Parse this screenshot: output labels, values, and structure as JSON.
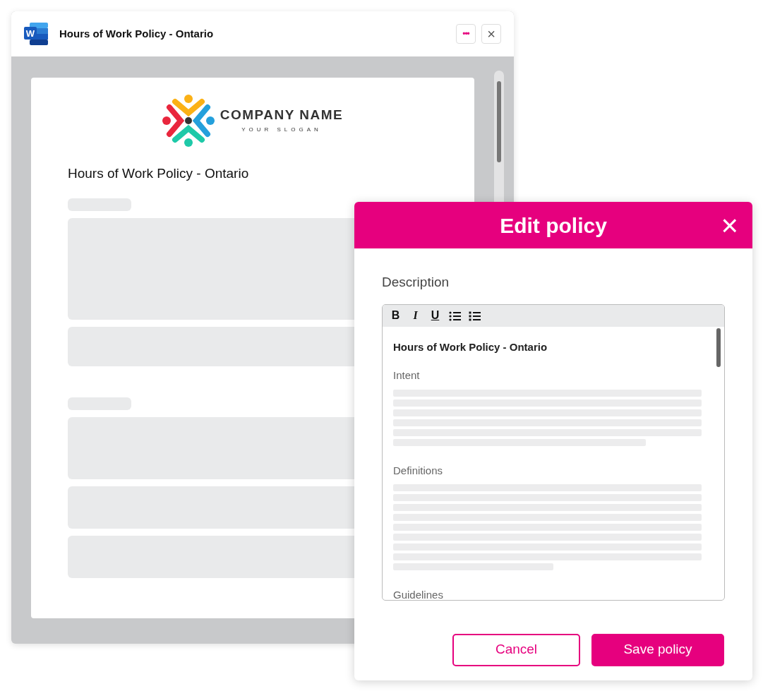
{
  "document_window": {
    "app_letter": "W",
    "title": "Hours of Work Policy - Ontario",
    "more_button": "•••",
    "close_button": "×",
    "page": {
      "company_name": "COMPANY NAME",
      "slogan": "YOUR SLOGAN",
      "heading": "Hours of Work Policy - Ontario"
    }
  },
  "modal": {
    "title": "Edit policy",
    "close_button": "×",
    "field_label": "Description",
    "toolbar": [
      {
        "kind": "bold",
        "label": "B"
      },
      {
        "kind": "italic",
        "label": "I"
      },
      {
        "kind": "underline",
        "label": "U"
      },
      {
        "kind": "bullets"
      },
      {
        "kind": "numbers"
      }
    ],
    "editor": {
      "heading": "Hours of Work Policy - Ontario",
      "sections": [
        {
          "title": "Intent"
        },
        {
          "title": "Definitions"
        },
        {
          "title": "Guidelines"
        }
      ]
    },
    "buttons": [
      {
        "kind": "secondary",
        "label": "Cancel"
      },
      {
        "kind": "primary",
        "label": "Save policy"
      }
    ]
  }
}
